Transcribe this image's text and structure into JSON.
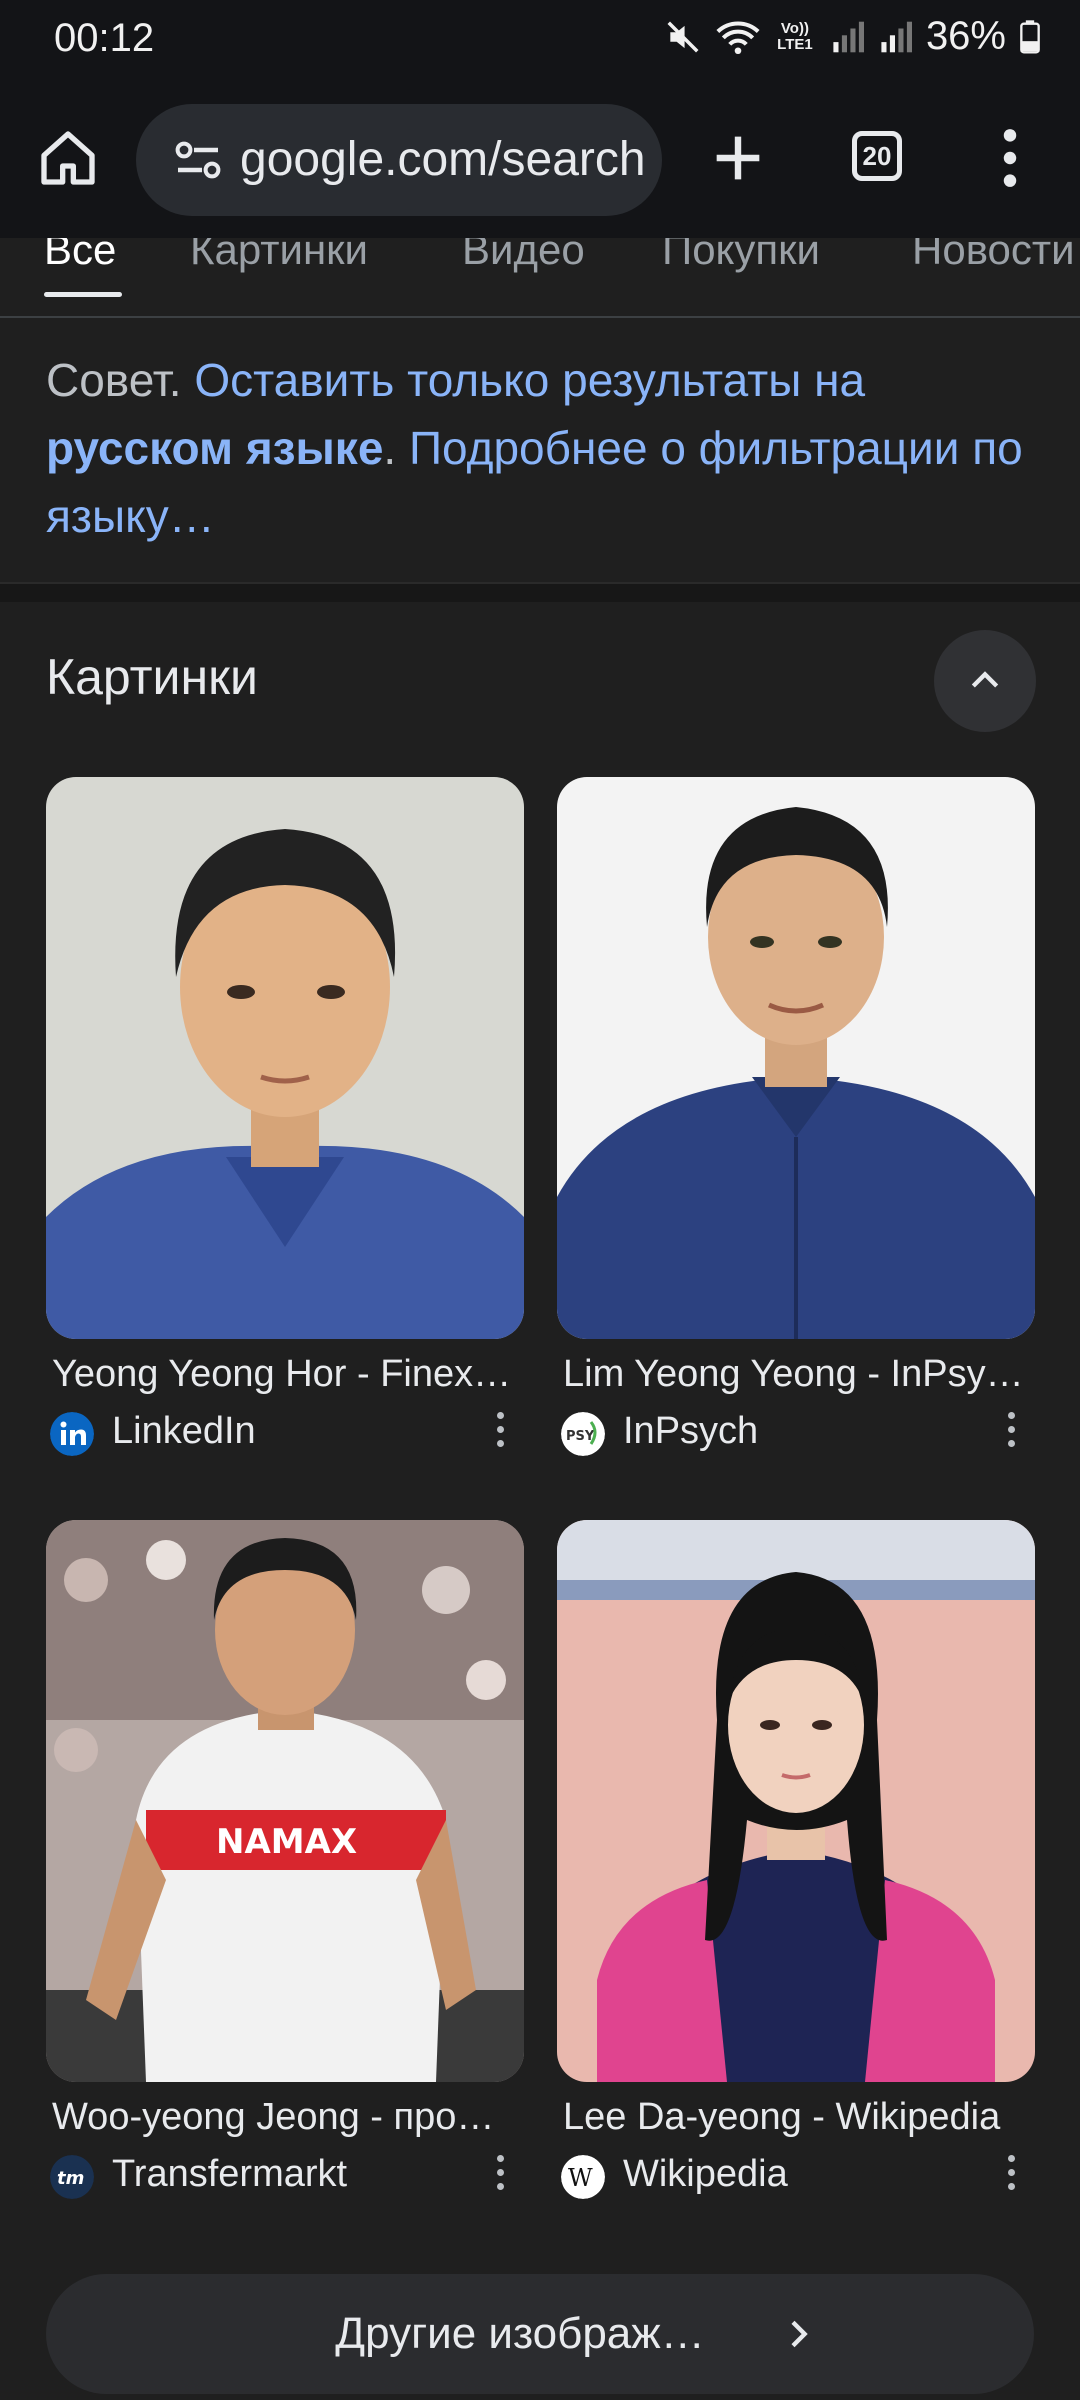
{
  "status_bar": {
    "time": "00:12",
    "battery": "36%",
    "icons": [
      "mute-icon",
      "wifi-icon",
      "volte-icon",
      "signal-icon",
      "signal-icon",
      "battery-icon"
    ],
    "volte_text": "Vo)) LTE1"
  },
  "browser": {
    "url": "google.com/search",
    "tab_count": "20",
    "icons": [
      "home-icon",
      "site-settings-icon",
      "plus-icon",
      "tab-switcher-icon",
      "more-vert-icon"
    ]
  },
  "search_tabs": [
    {
      "label": "Все",
      "active": true
    },
    {
      "label": "Картинки",
      "active": false
    },
    {
      "label": "Видео",
      "active": false
    },
    {
      "label": "Покупки",
      "active": false
    },
    {
      "label": "Новости",
      "active": false
    }
  ],
  "tip": {
    "prefix": "Совет.",
    "link1": "Оставить только результаты на",
    "link1_bold": "русском языке",
    "dot": ".",
    "link2": "Подробнее о фильтрации по языку…"
  },
  "images_section": {
    "title": "Картинки",
    "cards": [
      {
        "title": "Yeong Yeong Hor - Finex…",
        "source": "LinkedIn",
        "favicon": "linkedin-icon"
      },
      {
        "title": "Lim Yeong Yeong - InPsy…",
        "source": "InPsych",
        "favicon": "inpsych-icon"
      },
      {
        "title": "Woo-yeong Jeong - про…",
        "source": "Transfermarkt",
        "favicon": "transfermarkt-icon"
      },
      {
        "title": "Lee Da-yeong - Wikipedia",
        "source": "Wikipedia",
        "favicon": "wikipedia-icon"
      }
    ],
    "more_button": "Другие изображ…"
  },
  "colors": {
    "background": "#1f1f1f",
    "link": "#8ab4f8",
    "toolbar": "#131417"
  }
}
